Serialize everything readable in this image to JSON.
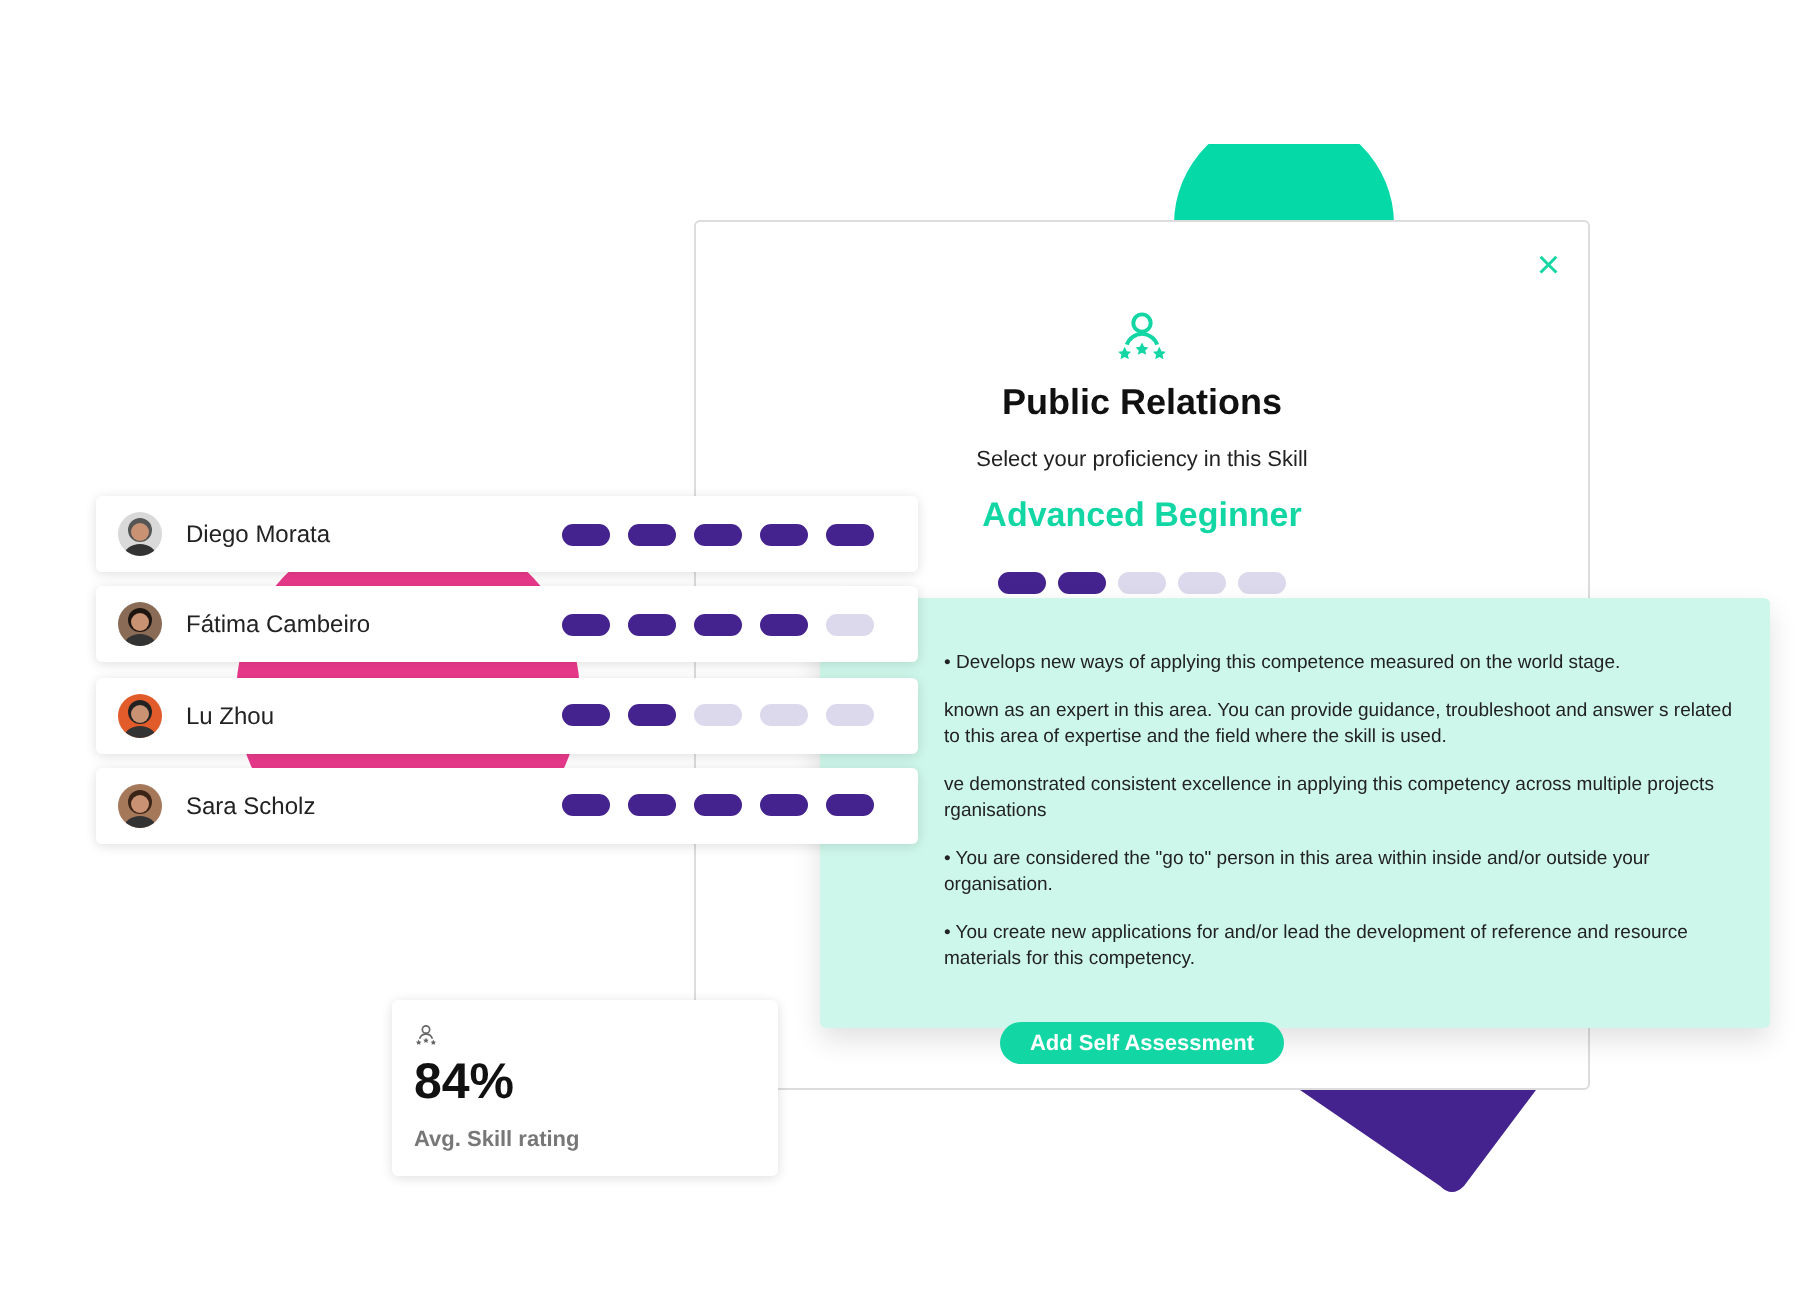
{
  "modal": {
    "title": "Public Relations",
    "subtitle": "Select your proficiency in this Skill",
    "level_name": "Advanced Beginner",
    "stars": 2,
    "close": "×",
    "description": [
      "• Develops new ways of applying this competence measured on the world stage.",
      "known as an expert in this area. You can provide guidance, troubleshoot and answer s related to this area of expertise and the field where the skill is used.",
      "ve demonstrated consistent excellence in applying this competency across multiple projects rganisations",
      "• You are considered the \"go to\" person in this area within inside and/or outside your organisation.",
      "• You create new applications for and/or lead the development of reference and resource materials for this competency."
    ],
    "button": "Add Self Assessment"
  },
  "people": [
    {
      "name": "Diego Morata",
      "stars": 5
    },
    {
      "name": "Fátima Cambeiro",
      "stars": 4
    },
    {
      "name": "Lu Zhou",
      "stars": 2
    },
    {
      "name": "Sara Scholz",
      "stars": 5
    }
  ],
  "stat": {
    "value": "84%",
    "label": "Avg. Skill rating"
  }
}
